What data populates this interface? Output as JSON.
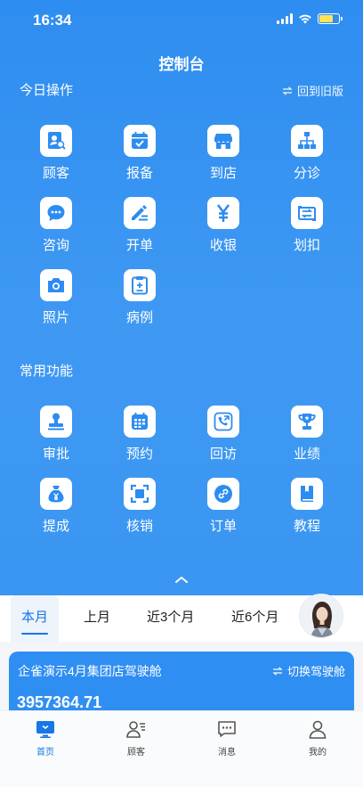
{
  "status_bar": {
    "time": "16:34"
  },
  "header": {
    "title": "控制台"
  },
  "today_ops": {
    "title": "今日操作",
    "switch_label": "回到旧版",
    "items": [
      {
        "label": "顾客",
        "icon": "customer-search-icon"
      },
      {
        "label": "报备",
        "icon": "calendar-check-icon"
      },
      {
        "label": "到店",
        "icon": "store-icon"
      },
      {
        "label": "分诊",
        "icon": "hierarchy-icon"
      },
      {
        "label": "咨询",
        "icon": "chat-bubble-icon"
      },
      {
        "label": "开单",
        "icon": "pen-icon"
      },
      {
        "label": "收银",
        "icon": "yen-icon"
      },
      {
        "label": "划扣",
        "icon": "transfer-icon"
      },
      {
        "label": "照片",
        "icon": "camera-icon"
      },
      {
        "label": "病例",
        "icon": "clipboard-medical-icon"
      }
    ]
  },
  "common_funcs": {
    "title": "常用功能",
    "items": [
      {
        "label": "审批",
        "icon": "stamp-icon"
      },
      {
        "label": "预约",
        "icon": "calendar-grid-icon"
      },
      {
        "label": "回访",
        "icon": "phone-callback-icon"
      },
      {
        "label": "业绩",
        "icon": "trophy-icon"
      },
      {
        "label": "提成",
        "icon": "money-bag-icon"
      },
      {
        "label": "核销",
        "icon": "scan-icon"
      },
      {
        "label": "订单",
        "icon": "link-icon"
      },
      {
        "label": "教程",
        "icon": "book-icon"
      }
    ]
  },
  "period_tabs": [
    {
      "label": "本月",
      "active": true
    },
    {
      "label": "上月",
      "active": false
    },
    {
      "label": "近3个月",
      "active": false
    },
    {
      "label": "近6个月",
      "active": false
    }
  ],
  "cockpit": {
    "name": "企雀演示4月集团店驾驶舱",
    "switch_label": "切换驾驶舱",
    "amount": "3957364.71"
  },
  "bottom_nav": [
    {
      "label": "首页",
      "icon": "monitor-icon",
      "active": true
    },
    {
      "label": "顾客",
      "icon": "user-list-icon",
      "active": false
    },
    {
      "label": "消息",
      "icon": "message-icon",
      "active": false
    },
    {
      "label": "我的",
      "icon": "person-icon",
      "active": false
    }
  ],
  "colors": {
    "primary": "#2e8df0",
    "accent": "#1677e5",
    "icon_blue": "#2d8cf0"
  }
}
